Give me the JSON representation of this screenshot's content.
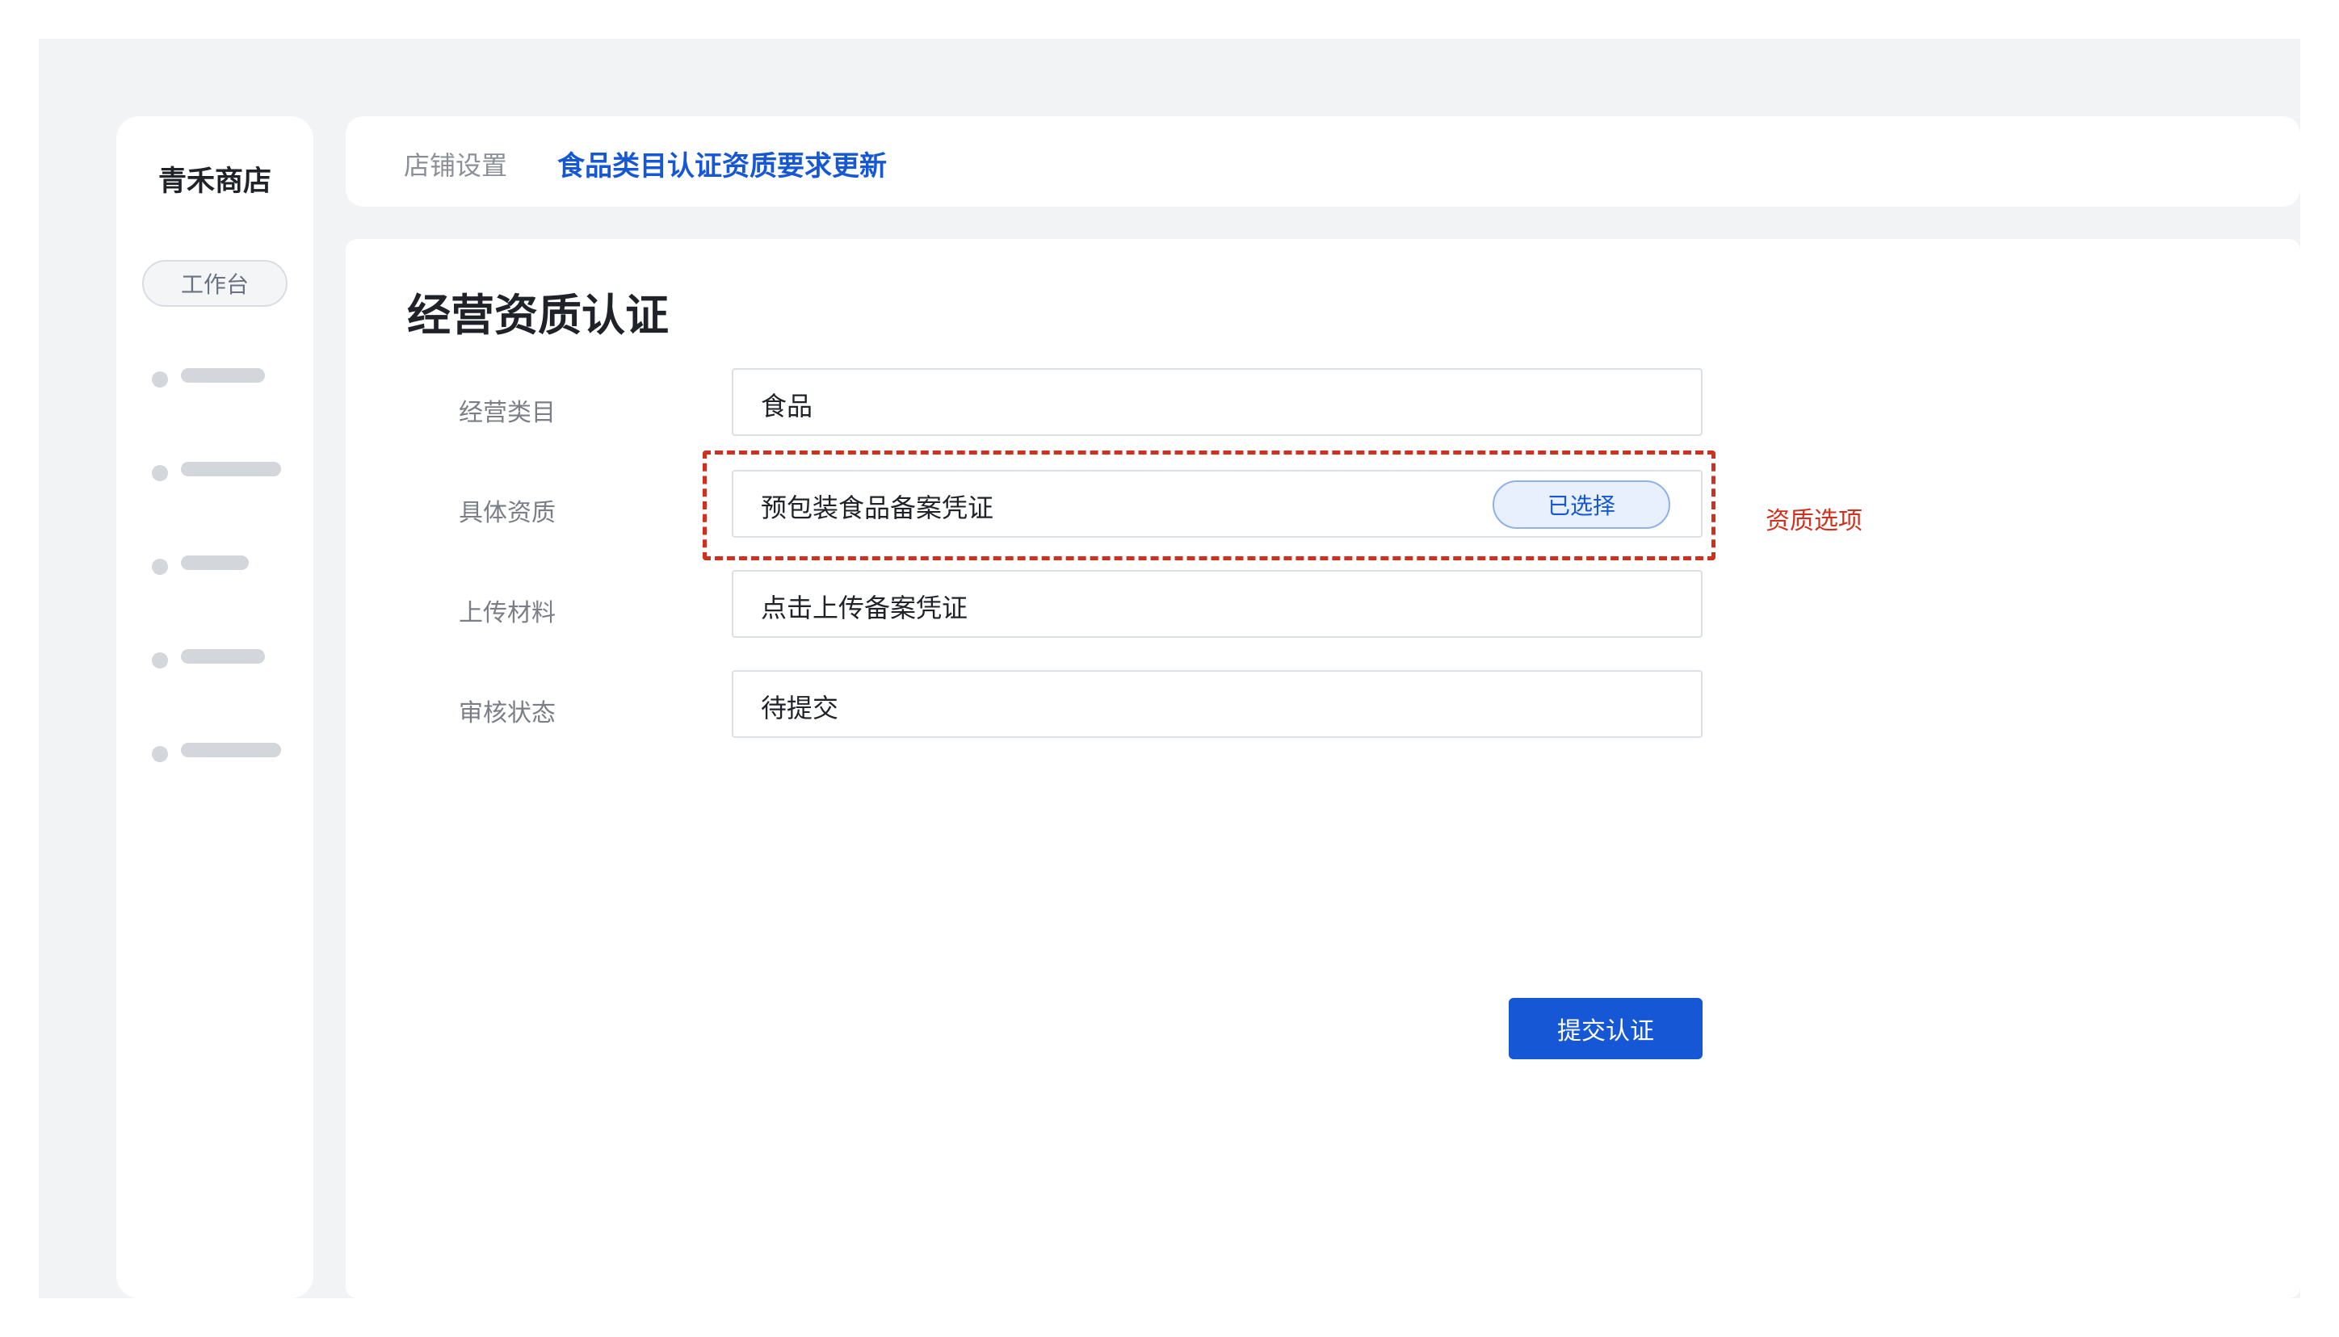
{
  "sidebar": {
    "brand": "青禾商店",
    "active_item": "工作台",
    "placeholder_items": 5
  },
  "breadcrumb": {
    "section": "店铺设置",
    "current": "食品类目认证资质要求更新"
  },
  "form": {
    "title": "经营资质认证",
    "rows": [
      {
        "label": "经营类目",
        "value": "食品"
      },
      {
        "label": "具体资质",
        "value": "预包装食品备案凭证",
        "chip": "已选择"
      },
      {
        "label": "上传材料",
        "value": "点击上传备案凭证"
      },
      {
        "label": "审核状态",
        "value": "待提交"
      }
    ],
    "submit_label": "提交认证"
  },
  "annotation": {
    "label": "资质选项",
    "color": "#d0311f"
  },
  "colors": {
    "accent": "#1657d6",
    "background": "#f2f3f5"
  }
}
